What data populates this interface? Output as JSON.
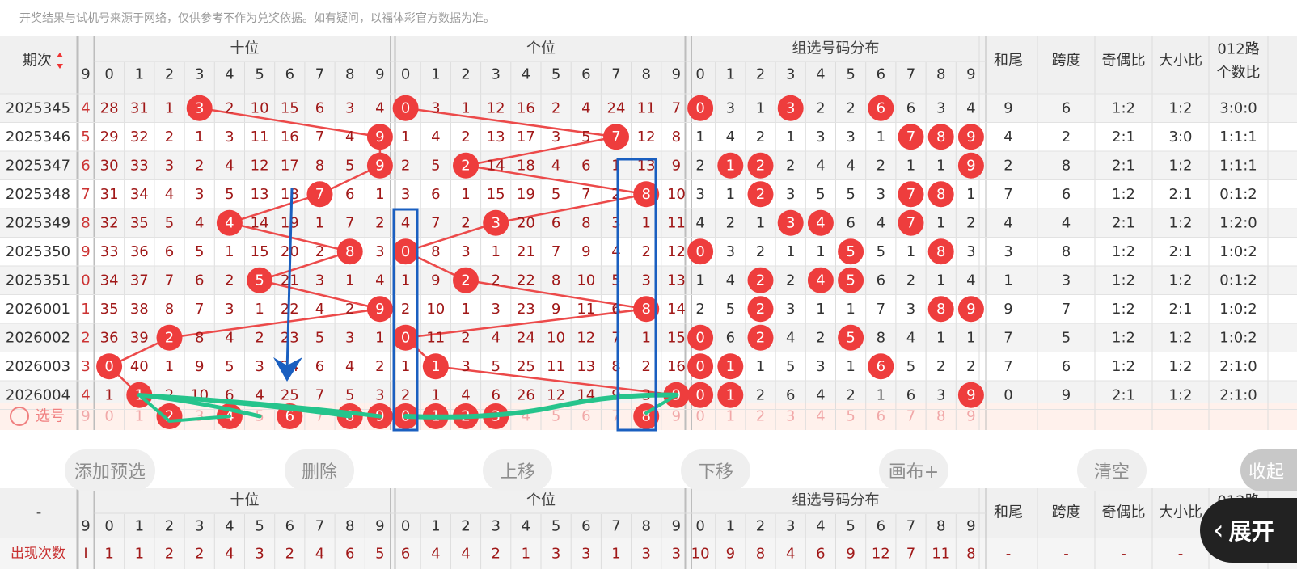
{
  "notice": "开奖结果与试机号来源于网络，仅供参考不作为兑奖依据。如有疑问，以福体彩官方数据为准。",
  "header": {
    "period": "期次",
    "sort_icon": "sort-up-down-icon",
    "groups": [
      "十位",
      "个位",
      "组选号码分布"
    ],
    "stats": [
      "和尾",
      "跨度",
      "奇偶比",
      "大小比",
      "012路\n个数比"
    ],
    "digits": [
      "0",
      "1",
      "2",
      "3",
      "4",
      "5",
      "6",
      "7",
      "8",
      "9"
    ],
    "partial_digit": "9"
  },
  "colors": {
    "hit": "#ee3d3d",
    "line": "#ec4a4a",
    "box": "#1a5fc0",
    "green": "#26c48c",
    "select_bg": "#fff1ec"
  },
  "rows": [
    {
      "period": "2025345",
      "pre": "4",
      "tens": [
        "28",
        "31",
        "1",
        "3",
        "2",
        "10",
        "15",
        "6",
        "3",
        "4"
      ],
      "units": [
        "0",
        "3",
        "1",
        "12",
        "16",
        "2",
        "4",
        "24",
        "11",
        "7"
      ],
      "group": [
        "0",
        "3",
        "1",
        "3",
        "2",
        "2",
        "6",
        "6",
        "3",
        "4"
      ],
      "tens_hit": [
        3
      ],
      "units_hit": [
        0
      ],
      "group_hit": [
        0,
        3,
        6
      ],
      "stats": [
        "9",
        "6",
        "1:2",
        "1:2",
        "3:0:0"
      ]
    },
    {
      "period": "2025346",
      "pre": "5",
      "tens": [
        "29",
        "32",
        "2",
        "1",
        "3",
        "11",
        "16",
        "7",
        "4",
        "9"
      ],
      "units": [
        "1",
        "4",
        "2",
        "13",
        "17",
        "3",
        "5",
        "7",
        "12",
        "8"
      ],
      "group": [
        "1",
        "4",
        "2",
        "1",
        "3",
        "3",
        "1",
        "7",
        "8",
        "9"
      ],
      "tens_hit": [
        9
      ],
      "units_hit": [
        7
      ],
      "group_hit": [
        7,
        8,
        9
      ],
      "stats": [
        "4",
        "2",
        "2:1",
        "3:0",
        "1:1:1"
      ]
    },
    {
      "period": "2025347",
      "pre": "6",
      "tens": [
        "30",
        "33",
        "3",
        "2",
        "4",
        "12",
        "17",
        "8",
        "5",
        "9"
      ],
      "units": [
        "2",
        "5",
        "2",
        "14",
        "18",
        "4",
        "6",
        "1",
        "13",
        "9"
      ],
      "group": [
        "2",
        "1",
        "2",
        "2",
        "4",
        "4",
        "2",
        "1",
        "1",
        "9"
      ],
      "tens_hit": [
        9
      ],
      "units_hit": [
        2
      ],
      "group_hit": [
        1,
        2,
        9
      ],
      "stats": [
        "2",
        "8",
        "2:1",
        "1:2",
        "1:1:1"
      ]
    },
    {
      "period": "2025348",
      "pre": "7",
      "tens": [
        "31",
        "34",
        "4",
        "3",
        "5",
        "13",
        "18",
        "7",
        "6",
        "1"
      ],
      "units": [
        "3",
        "6",
        "1",
        "15",
        "19",
        "5",
        "7",
        "2",
        "8",
        "10"
      ],
      "group": [
        "3",
        "1",
        "2",
        "3",
        "5",
        "5",
        "3",
        "7",
        "8",
        "1"
      ],
      "tens_hit": [
        7
      ],
      "units_hit": [
        8
      ],
      "group_hit": [
        2,
        7,
        8
      ],
      "stats": [
        "7",
        "6",
        "1:2",
        "2:1",
        "0:1:2"
      ]
    },
    {
      "period": "2025349",
      "pre": "8",
      "tens": [
        "32",
        "35",
        "5",
        "4",
        "4",
        "14",
        "19",
        "1",
        "7",
        "2"
      ],
      "units": [
        "4",
        "7",
        "2",
        "3",
        "20",
        "6",
        "8",
        "3",
        "1",
        "11"
      ],
      "group": [
        "4",
        "2",
        "1",
        "3",
        "4",
        "6",
        "4",
        "7",
        "1",
        "2"
      ],
      "tens_hit": [
        4
      ],
      "units_hit": [
        3
      ],
      "group_hit": [
        3,
        4,
        7
      ],
      "stats": [
        "4",
        "4",
        "2:1",
        "1:2",
        "1:2:0"
      ]
    },
    {
      "period": "2025350",
      "pre": "9",
      "tens": [
        "33",
        "36",
        "6",
        "5",
        "1",
        "15",
        "20",
        "2",
        "8",
        "3"
      ],
      "units": [
        "0",
        "8",
        "3",
        "1",
        "21",
        "7",
        "9",
        "4",
        "2",
        "12"
      ],
      "group": [
        "0",
        "3",
        "2",
        "1",
        "1",
        "5",
        "5",
        "1",
        "8",
        "3"
      ],
      "tens_hit": [
        8
      ],
      "units_hit": [
        0
      ],
      "group_hit": [
        0,
        5,
        8
      ],
      "stats": [
        "3",
        "8",
        "1:2",
        "2:1",
        "1:0:2"
      ]
    },
    {
      "period": "2025351",
      "pre": "0",
      "tens": [
        "34",
        "37",
        "7",
        "6",
        "2",
        "5",
        "21",
        "3",
        "1",
        "4"
      ],
      "units": [
        "1",
        "9",
        "2",
        "2",
        "22",
        "8",
        "10",
        "5",
        "3",
        "13"
      ],
      "group": [
        "1",
        "4",
        "2",
        "2",
        "4",
        "5",
        "6",
        "2",
        "1",
        "4"
      ],
      "tens_hit": [
        5
      ],
      "units_hit": [
        2
      ],
      "group_hit": [
        2,
        4,
        5
      ],
      "stats": [
        "1",
        "3",
        "1:2",
        "1:2",
        "0:1:2"
      ]
    },
    {
      "period": "2026001",
      "pre": "1",
      "tens": [
        "35",
        "38",
        "8",
        "7",
        "3",
        "1",
        "22",
        "4",
        "2",
        "9"
      ],
      "units": [
        "2",
        "10",
        "1",
        "3",
        "23",
        "9",
        "11",
        "6",
        "8",
        "14"
      ],
      "group": [
        "2",
        "5",
        "2",
        "3",
        "1",
        "1",
        "7",
        "3",
        "8",
        "9"
      ],
      "tens_hit": [
        9
      ],
      "units_hit": [
        8
      ],
      "group_hit": [
        2,
        8,
        9
      ],
      "stats": [
        "9",
        "7",
        "1:2",
        "2:1",
        "1:0:2"
      ]
    },
    {
      "period": "2026002",
      "pre": "2",
      "tens": [
        "36",
        "39",
        "2",
        "8",
        "4",
        "2",
        "23",
        "5",
        "3",
        "1"
      ],
      "units": [
        "0",
        "11",
        "2",
        "4",
        "24",
        "10",
        "12",
        "7",
        "1",
        "15"
      ],
      "group": [
        "0",
        "6",
        "2",
        "4",
        "2",
        "5",
        "8",
        "4",
        "1",
        "1"
      ],
      "tens_hit": [
        2
      ],
      "units_hit": [
        0
      ],
      "group_hit": [
        0,
        2,
        5
      ],
      "stats": [
        "7",
        "5",
        "1:2",
        "1:2",
        "1:0:2"
      ]
    },
    {
      "period": "2026003",
      "pre": "3",
      "tens": [
        "0",
        "40",
        "1",
        "9",
        "5",
        "3",
        "24",
        "6",
        "4",
        "2"
      ],
      "units": [
        "1",
        "1",
        "3",
        "5",
        "25",
        "11",
        "13",
        "8",
        "2",
        "16"
      ],
      "group": [
        "0",
        "1",
        "1",
        "5",
        "3",
        "1",
        "6",
        "5",
        "2",
        "2"
      ],
      "tens_hit": [
        0
      ],
      "units_hit": [
        1
      ],
      "group_hit": [
        0,
        1,
        6
      ],
      "stats": [
        "7",
        "6",
        "1:2",
        "1:2",
        "2:1:0"
      ]
    },
    {
      "period": "2026004",
      "pre": "4",
      "tens": [
        "1",
        "1",
        "2",
        "10",
        "6",
        "4",
        "25",
        "7",
        "5",
        "3"
      ],
      "units": [
        "2",
        "1",
        "4",
        "6",
        "26",
        "12",
        "14",
        "9",
        "3",
        "9"
      ],
      "group": [
        "0",
        "1",
        "2",
        "6",
        "4",
        "2",
        "1",
        "6",
        "3",
        "9"
      ],
      "tens_hit": [
        1
      ],
      "units_hit": [
        9
      ],
      "group_hit": [
        0,
        1,
        9
      ],
      "stats": [
        "0",
        "9",
        "2:1",
        "1:2",
        "2:1:0"
      ]
    }
  ],
  "select_row": {
    "radio_icon": "radio-circle-icon",
    "label": "选号",
    "pre": "9",
    "tens_sel": [
      2,
      4,
      6,
      8,
      9
    ],
    "units_sel": [
      0,
      1,
      2,
      3,
      8
    ]
  },
  "actions": [
    "添加预选",
    "删除",
    "上移",
    "下移",
    "画布+",
    "清空"
  ],
  "collapse_label": "收起",
  "expand": {
    "icon": "chevron-left-icon",
    "label": "展开"
  },
  "summary": {
    "period_dash": "-",
    "label": "出现次数",
    "pre": "I",
    "tens": [
      "1",
      "1",
      "2",
      "2",
      "4",
      "3",
      "2",
      "4",
      "6",
      "5"
    ],
    "units": [
      "6",
      "4",
      "4",
      "2",
      "1",
      "3",
      "3",
      "1",
      "3",
      "3"
    ],
    "group": [
      "10",
      "9",
      "8",
      "4",
      "6",
      "9",
      "12",
      "7",
      "11",
      "8"
    ],
    "stats": [
      "-",
      "-",
      "-",
      "-",
      "-"
    ]
  }
}
